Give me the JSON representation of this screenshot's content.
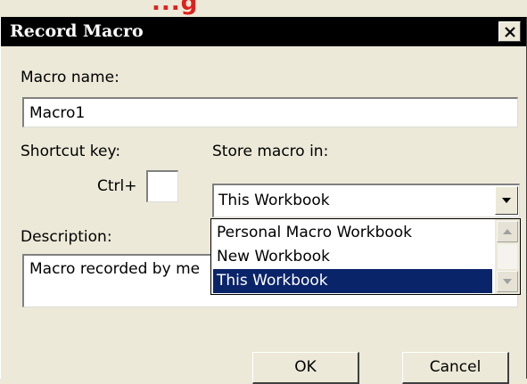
{
  "background": {
    "fragment_text": "...g"
  },
  "dialog": {
    "title": "Record Macro",
    "close_glyph": "×",
    "macro_name": {
      "label": "Macro name:",
      "value": "Macro1"
    },
    "shortcut_key": {
      "label": "Shortcut key:",
      "prefix": "Ctrl+",
      "value": ""
    },
    "store_macro_in": {
      "label": "Store macro in:",
      "selected": "This Workbook",
      "options": [
        "Personal Macro Workbook",
        "New Workbook",
        "This Workbook"
      ],
      "highlighted_option": "This Workbook"
    },
    "description": {
      "label": "Description:",
      "value": "Macro recorded by me"
    },
    "buttons": {
      "ok": "OK",
      "cancel": "Cancel"
    }
  },
  "colors": {
    "dialog_bg": "#ece9d8",
    "titlebar_bg": "#000000",
    "title_text": "#ffffff",
    "selection_bg": "#0a246a",
    "fragment_red": "#e0201e"
  }
}
